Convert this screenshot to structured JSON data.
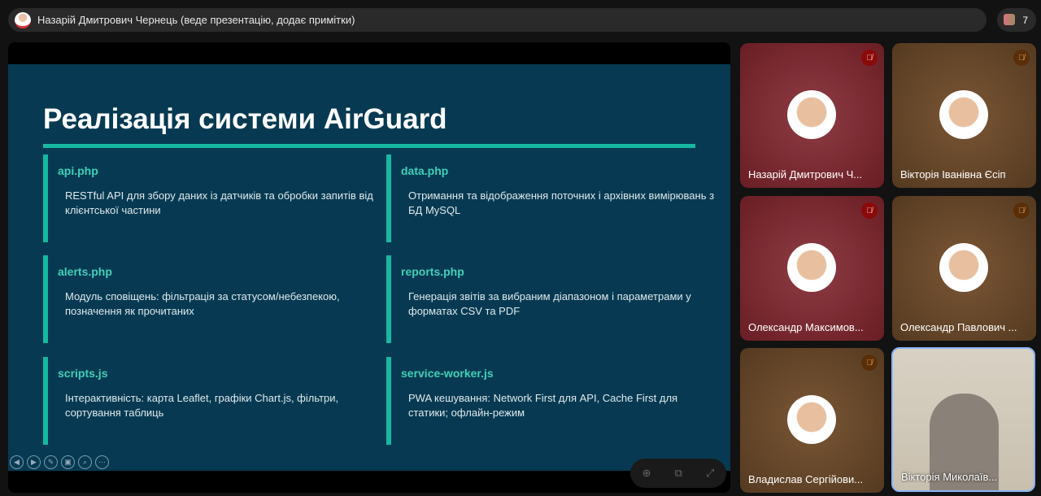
{
  "header": {
    "presenter": "Назарій Дмитрович Чернець (веде презентацію, додає примітки)",
    "participant_count": "7"
  },
  "slide": {
    "title": "Реалізація системи AirGuard",
    "cards": [
      {
        "file": "api.php",
        "desc": "RESTful API для збору даних із датчиків та обробки запитів від клієнтської частини"
      },
      {
        "file": "data.php",
        "desc": "Отримання та відображення поточних і архівних вимірювань з БД MySQL"
      },
      {
        "file": "alerts.php",
        "desc": "Модуль сповіщень: фільтрація за статусом/небезпекою, позначення як прочитаних"
      },
      {
        "file": "reports.php",
        "desc": "Генерація звітів за вибраним діапазоном і параметрами у форматах CSV та PDF"
      },
      {
        "file": "scripts.js",
        "desc": "Інтерактивність: карта Leaflet, графіки Chart.js, фільтри, сортування таблиць"
      },
      {
        "file": "service-worker.js",
        "desc": "PWA кешування: Network First для API, Cache First для статики; офлайн-режим"
      }
    ]
  },
  "participants": [
    {
      "name": "Назарій Дмитрович Ч..."
    },
    {
      "name": "Вікторія Іванівна Єсіп"
    },
    {
      "name": "Олександр Максимов..."
    },
    {
      "name": "Олександр Павлович ..."
    },
    {
      "name": "Владислав Сергійови..."
    },
    {
      "name": "Вікторія Миколаїв..."
    }
  ]
}
